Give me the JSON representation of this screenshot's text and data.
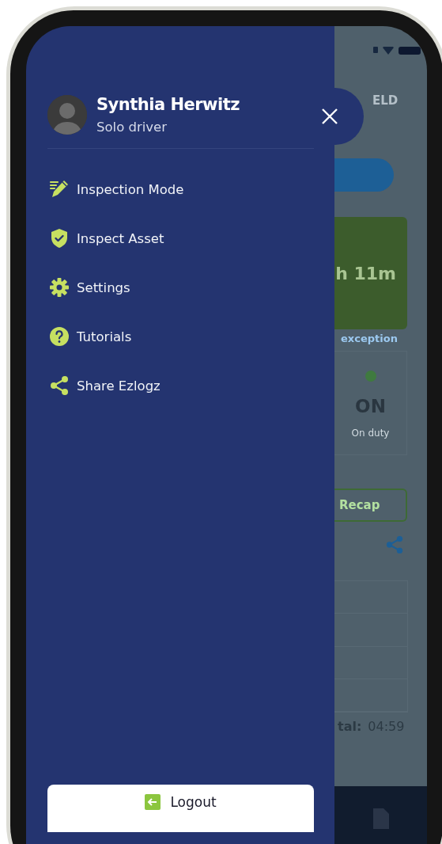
{
  "profile": {
    "name": "Synthia Herwitz",
    "role": "Solo driver"
  },
  "menu": [
    {
      "label": "Inspection Mode",
      "kind": "pencil"
    },
    {
      "label": "Inspect Asset",
      "kind": "shield"
    },
    {
      "label": "Settings",
      "kind": "gear"
    },
    {
      "label": "Tutorials",
      "kind": "help"
    },
    {
      "label": "Share Ezlogz",
      "kind": "share"
    }
  ],
  "logout": {
    "label": "Logout"
  },
  "background_screen": {
    "tab": "ELD",
    "timer": "h 11m",
    "link": "exception",
    "status": {
      "code": "ON",
      "label": "On duty"
    },
    "recap_button": "Recap",
    "total_label": "tal:",
    "total_value": "04:59"
  }
}
